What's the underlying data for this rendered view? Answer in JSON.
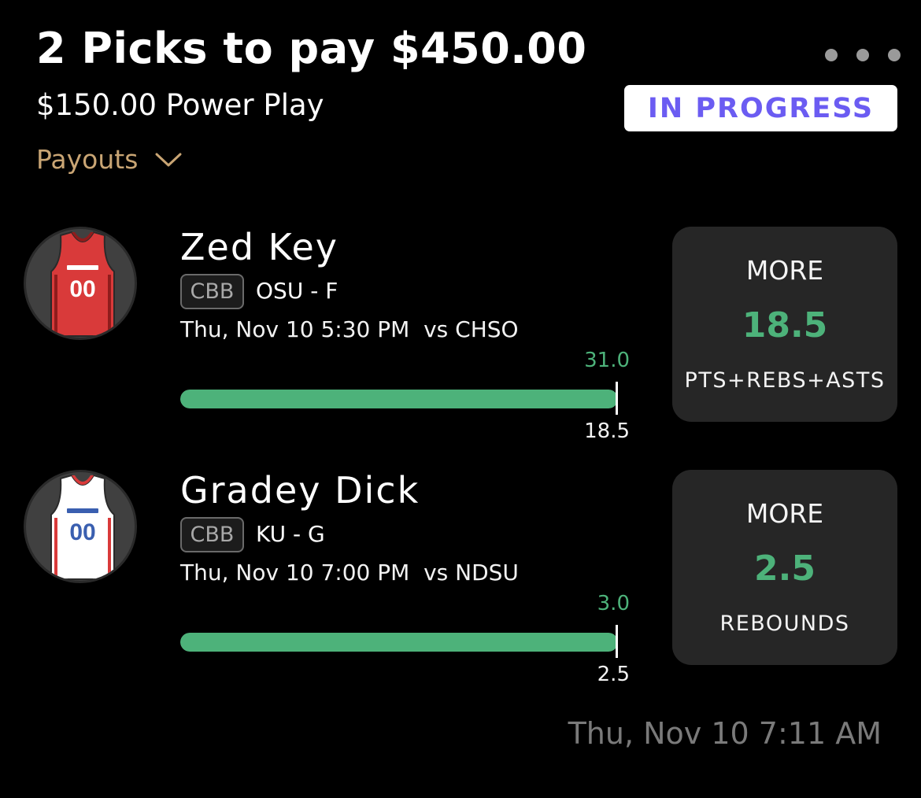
{
  "header": {
    "title": "2 Picks to pay $450.00",
    "subtitle": "$150.00 Power Play",
    "payouts_label": "Payouts",
    "status": "IN PROGRESS",
    "status_color": "#6b5cf2"
  },
  "picks": [
    {
      "player": "Zed Key",
      "league": "CBB",
      "team_position": "OSU - F",
      "game": "Thu, Nov 10 5:30 PM  vs CHSO",
      "actual": "31.0",
      "line": "18.5",
      "progress_fraction": 1.0,
      "direction": "MORE",
      "stat": "PTS+REBS+ASTS",
      "jersey": {
        "number": "00",
        "body_color": "#d93a3a",
        "trim_color": "#8f1c1c",
        "number_color": "#ffffff"
      }
    },
    {
      "player": "Gradey Dick",
      "league": "CBB",
      "team_position": "KU - G",
      "game": "Thu, Nov 10 7:00 PM  vs NDSU",
      "actual": "3.0",
      "line": "2.5",
      "progress_fraction": 1.0,
      "direction": "MORE",
      "stat": "REBOUNDS",
      "jersey": {
        "number": "00",
        "body_color": "#ffffff",
        "trim_color": "#d93a3a",
        "number_color": "#3a5fb0"
      }
    }
  ],
  "footer": {
    "timestamp": "Thu, Nov 10 7:11 AM"
  },
  "colors": {
    "accent_green": "#4db27a",
    "payouts_gold": "#c9a574"
  }
}
